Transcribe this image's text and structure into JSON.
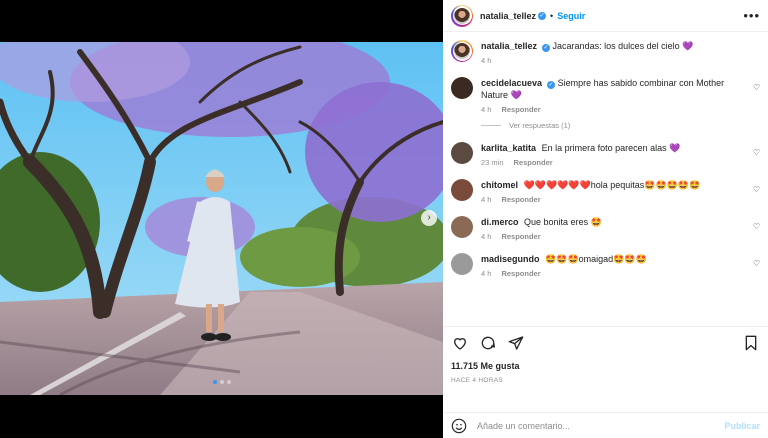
{
  "header": {
    "username": "natalia_tellez",
    "verified_icon": "verified-badge-icon",
    "separator": "•",
    "follow_label": "Seguir",
    "more_icon": "more-options-icon"
  },
  "caption": {
    "username": "natalia_tellez",
    "text": "Jacarandas: los dulces del cielo 💜",
    "time": "4 h"
  },
  "comments": [
    {
      "username": "cecidelacueva",
      "verified": true,
      "text": "Siempre has sabido combinar con Mother Nature 💜",
      "time": "4 h",
      "reply": "Responder",
      "avatar_color": "#3a2a22",
      "view_replies": "Ver respuestas (1)"
    },
    {
      "username": "karlita_katita",
      "verified": false,
      "text": "En la primera foto parecen alas 💜",
      "time": "23 min",
      "reply": "Responder",
      "avatar_color": "#5b4a3f"
    },
    {
      "username": "chitomel",
      "verified": false,
      "text": "❤️❤️❤️❤️❤️❤️hola pequitas🤩🤩🤩🤩🤩",
      "time": "4 h",
      "reply": "Responder",
      "avatar_color": "#7a4b3a"
    },
    {
      "username": "di.merco",
      "verified": false,
      "text": "Que bonita eres 🤩",
      "time": "4 h",
      "reply": "Responder",
      "avatar_color": "#8a6a55"
    },
    {
      "username": "madisegundo",
      "verified": false,
      "text": "🤩🤩🤩omaigad🤩🤩🤩",
      "time": "4 h",
      "reply": "Responder",
      "avatar_color": "#9a9a9a"
    }
  ],
  "actions": {
    "like_icon": "heart-icon",
    "comment_icon": "comment-icon",
    "share_icon": "share-icon",
    "save_icon": "bookmark-icon",
    "likes": "11.715 Me gusta",
    "ago": "HACE 4 HORAS"
  },
  "add_comment": {
    "placeholder": "Añade un comentario...",
    "publish": "Publicar"
  },
  "media": {
    "next_icon": "chevron-right-icon"
  },
  "colors": {
    "accent": "#0095f6",
    "verified": "#3897f0",
    "jacaranda": "#9b7fd6",
    "sky": "#63c4f2"
  }
}
